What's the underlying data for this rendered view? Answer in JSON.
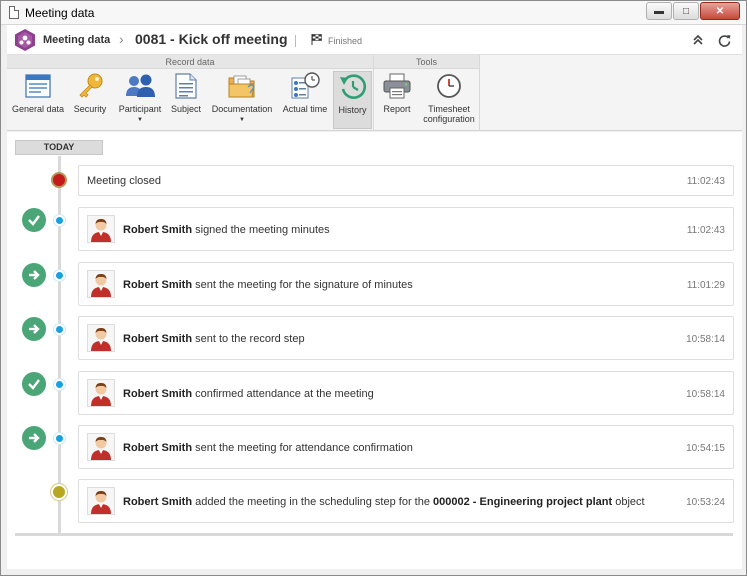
{
  "window": {
    "title": "Meeting data"
  },
  "header": {
    "breadcrumb_root": "Meeting data",
    "record_title": "0081 - Kick off meeting",
    "status": "Finished"
  },
  "ribbon": {
    "groups": [
      {
        "label": "Record data"
      },
      {
        "label": "Tools"
      }
    ],
    "buttons": {
      "general_data": "General data",
      "security": "Security",
      "participant": "Participant",
      "subject": "Subject",
      "documentation": "Documentation",
      "actual_time": "Actual time",
      "history": "History",
      "report": "Report",
      "timesheet_line1": "Timesheet",
      "timesheet_line2": "configuration"
    },
    "active": "History"
  },
  "timeline": {
    "today_label": "TODAY",
    "events": [
      {
        "type": "system",
        "dot": "red",
        "status_icon": "none",
        "text": "Meeting closed",
        "time": "11:02:43"
      },
      {
        "type": "user",
        "dot": "blue",
        "status_icon": "check-icon",
        "user": "Robert Smith",
        "text": "signed the meeting minutes",
        "time": "11:02:43"
      },
      {
        "type": "user",
        "dot": "blue",
        "status_icon": "arrow-right-icon",
        "user": "Robert Smith",
        "text": "sent the meeting for the signature of minutes",
        "time": "11:01:29"
      },
      {
        "type": "user",
        "dot": "blue",
        "status_icon": "arrow-right-icon",
        "user": "Robert Smith",
        "text": "sent to the record step",
        "time": "10:58:14"
      },
      {
        "type": "user",
        "dot": "blue",
        "status_icon": "check-icon",
        "user": "Robert Smith",
        "text": "confirmed attendance at the meeting",
        "time": "10:58:14"
      },
      {
        "type": "user",
        "dot": "blue",
        "status_icon": "arrow-right-icon",
        "user": "Robert Smith",
        "text": "sent the meeting for attendance confirmation",
        "time": "10:54:15"
      },
      {
        "type": "user",
        "dot": "olive",
        "status_icon": "none",
        "user": "Robert Smith",
        "text": "added the meeting in the scheduling step for the",
        "object": "000002 - Engineering project plant",
        "text_after": "object",
        "time": "10:53:24"
      }
    ]
  },
  "colors": {
    "accent_green": "#4aa577",
    "dot_blue": "#1a9fe0",
    "dot_red": "#c41a1a",
    "dot_olive": "#b7a722",
    "logo_purple": "#8e3f8e"
  }
}
